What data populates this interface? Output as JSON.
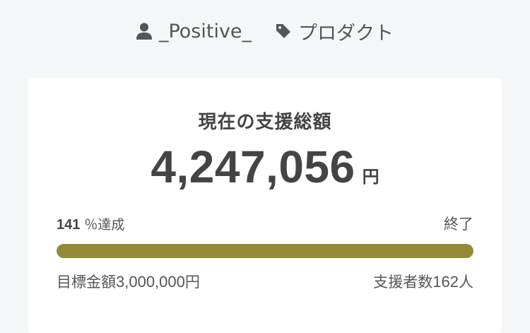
{
  "meta": {
    "author": "_Positive_",
    "author_icon": "user-icon",
    "category": "プロダクト",
    "category_icon": "tag-icon"
  },
  "summary": {
    "title": "現在の支援総額",
    "amount": "4,247,056",
    "amount_unit": "円",
    "rate_value": "141",
    "rate_suffix": "％達成",
    "status": "終了",
    "progress_percent": 100,
    "goal_label": "目標金額",
    "goal_amount": "3,000,000",
    "goal_unit": "円",
    "supporters_label": "支援者数",
    "supporters_count": "162",
    "supporters_unit": "人"
  },
  "colors": {
    "progress_fill": "#948a35",
    "background": "#f5f6f8",
    "card": "#ffffff"
  }
}
